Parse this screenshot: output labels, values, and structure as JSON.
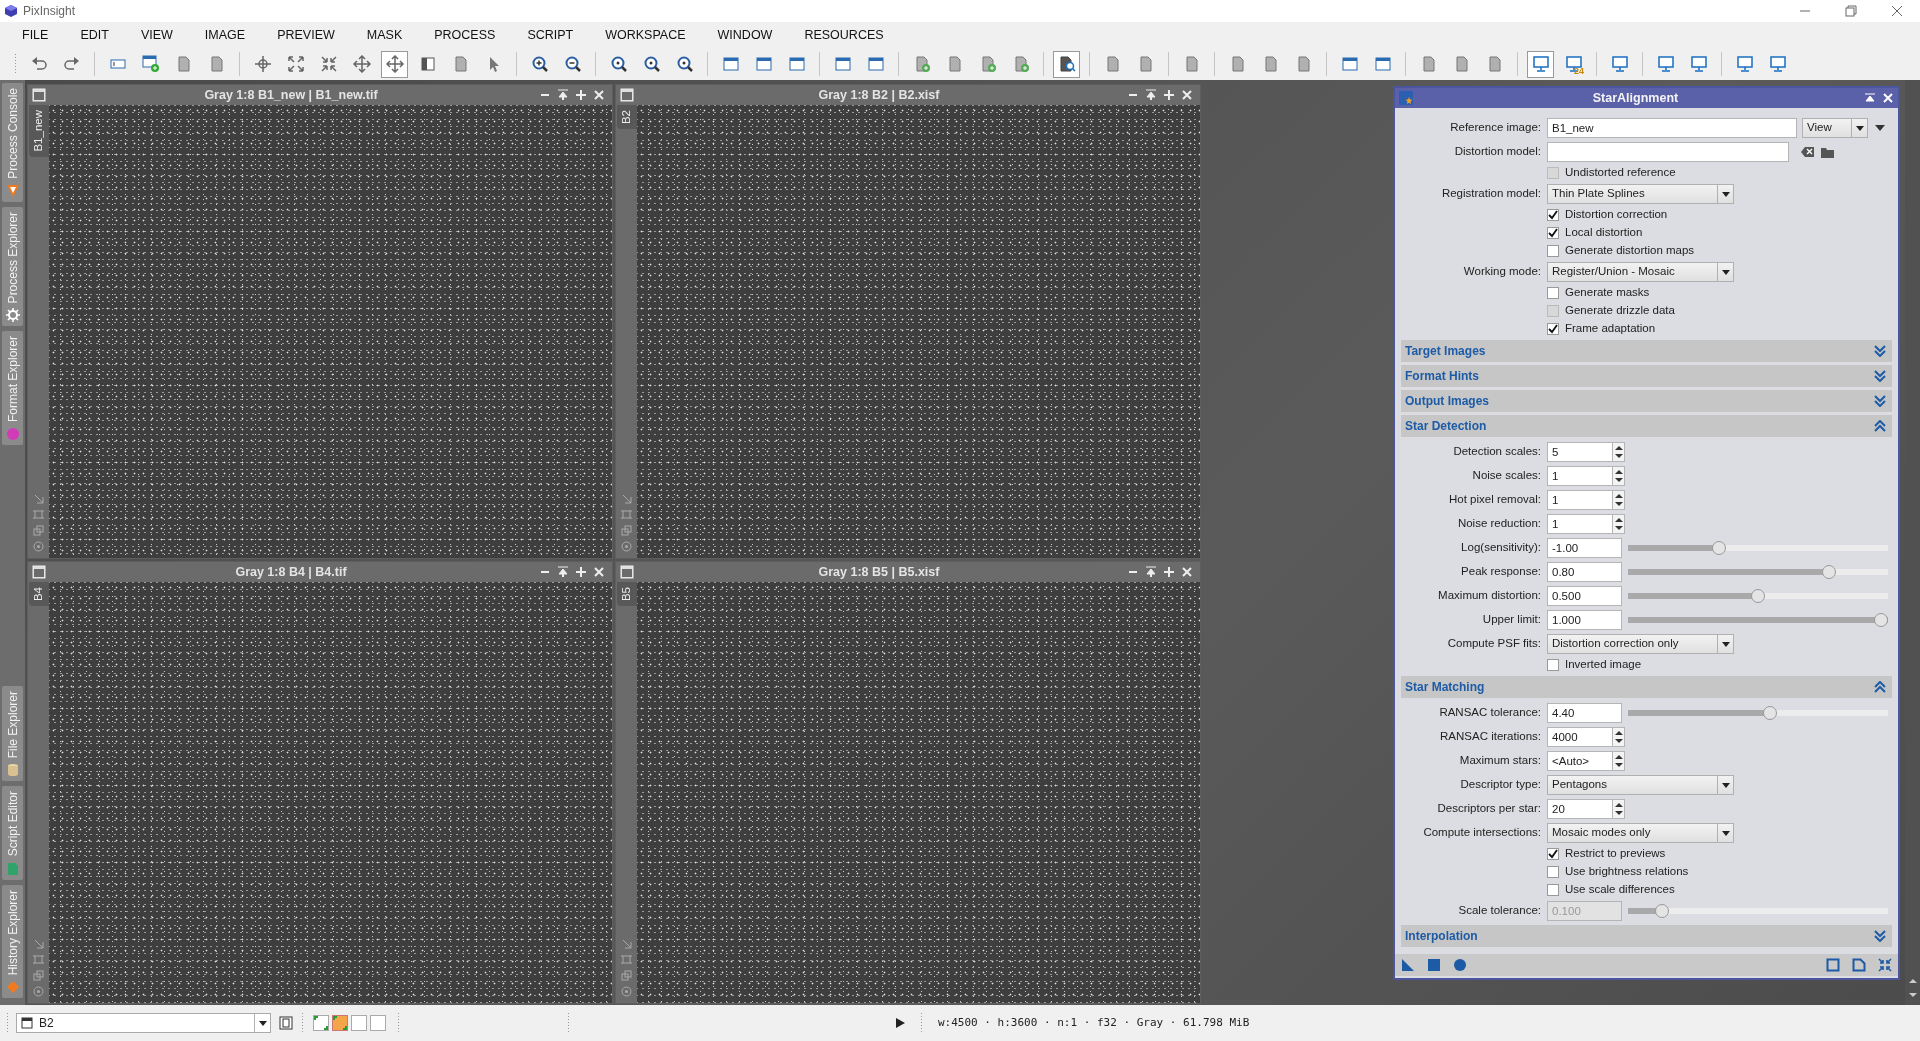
{
  "app_title": "PixInsight",
  "menu": [
    "FILE",
    "EDIT",
    "VIEW",
    "IMAGE",
    "PREVIEW",
    "MASK",
    "PROCESS",
    "SCRIPT",
    "WORKSPACE",
    "WINDOW",
    "RESOURCES"
  ],
  "toolbar": [
    [
      {
        "pressed": false
      },
      {
        "pressed": false
      }
    ],
    [
      {
        "pressed": false
      },
      {
        "pressed": false
      },
      {
        "pressed": false
      },
      {
        "pressed": false
      }
    ],
    [
      {
        "pressed": false
      },
      {
        "pressed": false
      },
      {
        "pressed": false
      },
      {
        "pressed": false
      },
      {
        "pressed": true
      },
      {
        "pressed": false
      },
      {
        "pressed": false
      },
      {
        "pressed": false
      }
    ],
    [
      {
        "pressed": false
      },
      {
        "pressed": false
      }
    ],
    [
      {
        "pressed": false
      },
      {
        "pressed": false
      },
      {
        "pressed": false
      }
    ],
    [
      {
        "pressed": false
      },
      {
        "pressed": false
      },
      {
        "pressed": false
      }
    ],
    [
      {
        "pressed": false
      },
      {
        "pressed": false
      }
    ],
    [
      {
        "pressed": false
      },
      {
        "pressed": false
      },
      {
        "pressed": false
      },
      {
        "pressed": false
      }
    ],
    [
      {
        "pressed": true
      }
    ],
    [
      {
        "pressed": false
      },
      {
        "pressed": false
      }
    ],
    [
      {
        "pressed": false
      }
    ],
    [
      {
        "pressed": false
      },
      {
        "pressed": false
      },
      {
        "pressed": false
      }
    ],
    [
      {
        "pressed": false
      },
      {
        "pressed": false
      }
    ],
    [
      {
        "pressed": false
      },
      {
        "pressed": false
      },
      {
        "pressed": false
      }
    ],
    [
      {
        "pressed": true
      },
      {
        "pressed": false,
        "label": "24"
      }
    ],
    [
      {
        "pressed": false
      }
    ],
    [
      {
        "pressed": false
      },
      {
        "pressed": false
      }
    ],
    [
      {
        "pressed": false
      },
      {
        "pressed": false
      }
    ]
  ],
  "left_dock": {
    "top": [
      {
        "label": "Process Console"
      },
      {
        "label": "Process Explorer"
      },
      {
        "label": "Format Explorer"
      }
    ],
    "bottom": [
      {
        "label": "File Explorer"
      },
      {
        "label": "Script Editor"
      },
      {
        "label": "History Explorer"
      }
    ]
  },
  "windows": [
    {
      "title": "Gray 1:8 B1_new | B1_new.tif",
      "tab": "B1_new"
    },
    {
      "title": "Gray 1:8 B2 | B2.xisf",
      "tab": "B2"
    },
    {
      "title": "Gray 1:8 B4 | B4.tif",
      "tab": "B4"
    },
    {
      "title": "Gray 1:8 B5 | B5.xisf",
      "tab": "B5"
    }
  ],
  "panel": {
    "title": "StarAlignment",
    "rows": [
      {
        "kind": "view",
        "label": "Reference image:",
        "value": "B1_new",
        "button": "View"
      },
      {
        "kind": "file",
        "label": "Distortion model:"
      },
      {
        "kind": "check",
        "label": "Undistorted reference",
        "checked": false,
        "disabled": true
      },
      {
        "kind": "combo",
        "label": "Registration model:",
        "value": "Thin Plate Splines"
      },
      {
        "kind": "check",
        "label": "Distortion correction",
        "checked": true
      },
      {
        "kind": "check",
        "label": "Local distortion",
        "checked": true
      },
      {
        "kind": "check",
        "label": "Generate distortion maps",
        "checked": false
      },
      {
        "kind": "combo",
        "label": "Working mode:",
        "value": "Register/Union - Mosaic"
      },
      {
        "kind": "check",
        "label": "Generate masks",
        "checked": false
      },
      {
        "kind": "check",
        "label": "Generate drizzle data",
        "checked": false,
        "disabled": true
      },
      {
        "kind": "check",
        "label": "Frame adaptation",
        "checked": true
      }
    ],
    "sections": [
      {
        "title": "Target Images",
        "expanded": false
      },
      {
        "title": "Format Hints",
        "expanded": false
      },
      {
        "title": "Output Images",
        "expanded": false
      },
      {
        "title": "Star Detection",
        "expanded": true,
        "rows": [
          {
            "kind": "spin",
            "label": "Detection scales:",
            "value": "5"
          },
          {
            "kind": "spin",
            "label": "Noise scales:",
            "value": "1"
          },
          {
            "kind": "spin",
            "label": "Hot pixel removal:",
            "value": "1"
          },
          {
            "kind": "spin",
            "label": "Noise reduction:",
            "value": "1"
          },
          {
            "kind": "slider",
            "label": "Log(sensitivity):",
            "value": "-1.00",
            "level": 0.34
          },
          {
            "kind": "slider",
            "label": "Peak response:",
            "value": "0.80",
            "level": 0.79
          },
          {
            "kind": "slider",
            "label": "Maximum distortion:",
            "value": "0.500",
            "level": 0.5
          },
          {
            "kind": "slider",
            "label": "Upper limit:",
            "value": "1.000",
            "level": 1
          },
          {
            "kind": "combo",
            "label": "Compute PSF fits:",
            "value": "Distortion correction only"
          },
          {
            "kind": "check",
            "label": "Inverted image",
            "checked": false
          }
        ]
      },
      {
        "title": "Star Matching",
        "expanded": true,
        "rows": [
          {
            "kind": "slider",
            "label": "RANSAC tolerance:",
            "value": "4.40",
            "level": 0.55
          },
          {
            "kind": "spin",
            "label": "RANSAC iterations:",
            "value": "4000"
          },
          {
            "kind": "spin",
            "label": "Maximum stars:",
            "value": "<Auto>"
          },
          {
            "kind": "combo",
            "label": "Descriptor type:",
            "value": "Pentagons"
          },
          {
            "kind": "spin",
            "label": "Descriptors per star:",
            "value": "20"
          },
          {
            "kind": "combo",
            "label": "Compute intersections:",
            "value": "Mosaic modes only"
          },
          {
            "kind": "check",
            "label": "Restrict to previews",
            "checked": true
          },
          {
            "kind": "check",
            "label": "Use brightness relations",
            "checked": false
          },
          {
            "kind": "check",
            "label": "Use scale differences",
            "checked": false
          },
          {
            "kind": "slider",
            "label": "Scale tolerance:",
            "value": "0.100",
            "level": 0.11,
            "disabled": true
          }
        ]
      },
      {
        "title": "Interpolation",
        "expanded": false
      }
    ]
  },
  "status_bar": {
    "view": "B2",
    "modes": [
      {
        "selected": false
      },
      {
        "selected": true
      },
      {
        "selected": false
      },
      {
        "selected": false
      }
    ],
    "info": "w:4500 · h:3600 · n:1 · f32 · Gray · 61.798 MiB"
  }
}
